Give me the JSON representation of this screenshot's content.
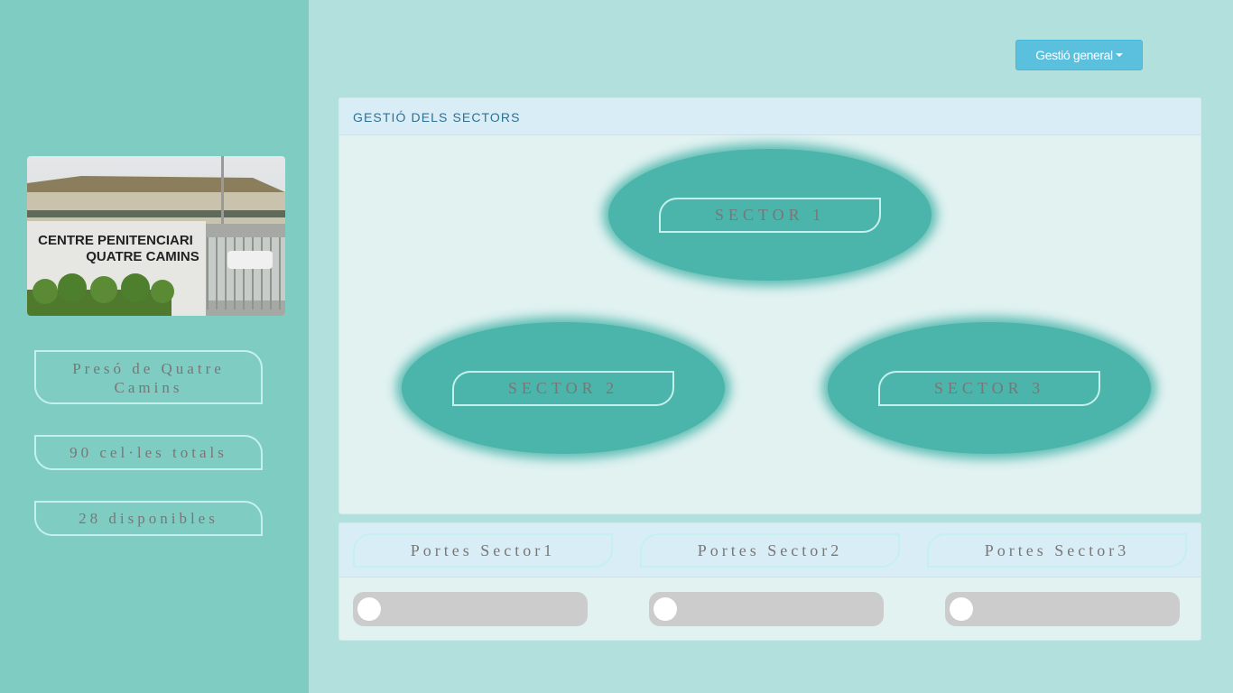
{
  "sidebar": {
    "photo_sign_line1": "CENTRE PENITENCIARI",
    "photo_sign_line2": "QUATRE CAMINS",
    "prison_name": "Presó de Quatre Camins",
    "total_cells": "90 cel·les totals",
    "available": "28 disponibles"
  },
  "header": {
    "dropdown_label": "Gestió general"
  },
  "sectors_panel": {
    "title": "GESTIÓ DELS SECTORS",
    "sectors": [
      "SECTOR 1",
      "SECTOR 2",
      "SECTOR 3"
    ]
  },
  "doors_panel": {
    "titles": [
      "Portes Sector1",
      "Portes Sector2",
      "Portes Sector3"
    ],
    "toggles_on": [
      false,
      false,
      false
    ]
  },
  "colors": {
    "sidebar": "#7fccc2",
    "background": "#b2e0dc",
    "sector_fill": "#4bb5ab",
    "button": "#5bc0de"
  }
}
